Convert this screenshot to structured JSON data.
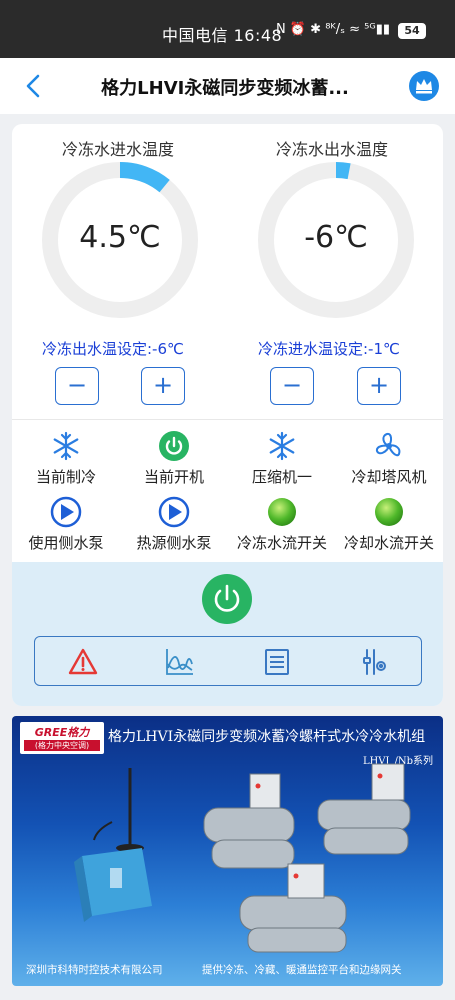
{
  "status_bar": {
    "time": "中国电信 16:48",
    "icons": "N ⏰ ✱ ⁸ᴷ/ₛ ≈ ⁵ᴳ▮▮",
    "battery": "54"
  },
  "header": {
    "title": "格力LHVI永磁同步变频冰蓄...",
    "back_icon": "chevron-left-icon",
    "crown_icon": "crown-icon"
  },
  "gauges": [
    {
      "label": "冷冻水进水温度",
      "value": "4.5℃",
      "fill_fraction": 0.11,
      "setpoint": "冷冻出水温设定:-6℃"
    },
    {
      "label": "冷冻水出水温度",
      "value": "-6℃",
      "fill_fraction": 0.03,
      "setpoint": "冷冻进水温设定:-1℃"
    }
  ],
  "stepper": {
    "minus": "−",
    "plus": "+"
  },
  "status_items": [
    {
      "label": "当前制冷",
      "icon": "snowflake-icon"
    },
    {
      "label": "当前开机",
      "icon": "power-on-icon"
    },
    {
      "label": "压缩机一",
      "icon": "snowflake-icon"
    },
    {
      "label": "冷却塔风机",
      "icon": "fan-icon"
    },
    {
      "label": "使用侧水泵",
      "icon": "pump-icon"
    },
    {
      "label": "热源侧水泵",
      "icon": "pump-icon"
    },
    {
      "label": "冷冻水流开关",
      "icon": "green-ball-icon"
    },
    {
      "label": "冷却水流开关",
      "icon": "green-ball-icon"
    }
  ],
  "toolbar": [
    "alarm-icon",
    "chart-icon",
    "list-icon",
    "settings-sliders-icon"
  ],
  "colors": {
    "accent_blue": "#2a6fd1",
    "gauge_arc": "#42b6f5",
    "power_green": "#28b463",
    "setpoint_blue": "#1a3fd6"
  },
  "banner": {
    "logo_text": "GREE格力",
    "logo_sub": "(格力中央空调)",
    "title": "格力LHVI永磁同步变频冰蓄冷螺杆式水冷冷水机组",
    "subtitle": "LHVI_/Nb系列",
    "footer_left": "深圳市科特时控技术有限公司",
    "footer_right": "提供冷冻、冷藏、暖通监控平台和边缘网关"
  }
}
